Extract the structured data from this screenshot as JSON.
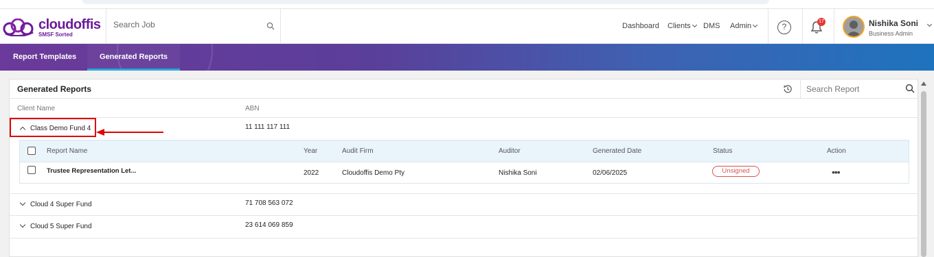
{
  "brand": {
    "name": "cloudoffis",
    "tagline": "SMSF Sorted",
    "color": "#6a1b9a"
  },
  "header": {
    "search_placeholder": "Search Job",
    "nav": {
      "dashboard": "Dashboard",
      "clients": "Clients",
      "dms": "DMS",
      "admin": "Admin"
    },
    "help_icon": "question-circle-icon",
    "notifications_count": "17",
    "user": {
      "name": "Nishika Soni",
      "role": "Business Admin"
    }
  },
  "tabs": [
    {
      "label": "Report Templates",
      "active": false
    },
    {
      "label": "Generated Reports",
      "active": true
    }
  ],
  "panel": {
    "title": "Generated Reports",
    "search_placeholder": "Search Report",
    "columns": {
      "client_name": "Client Name",
      "abn": "ABN"
    },
    "clients": [
      {
        "name": "Class Demo Fund 4",
        "abn": "11 111 117 111",
        "expanded": true
      },
      {
        "name": "Cloud 4 Super Fund",
        "abn": "71 708 563 072",
        "expanded": false
      },
      {
        "name": "Cloud 5 Super Fund",
        "abn": "23 614 069 859",
        "expanded": false
      }
    ],
    "sub_table": {
      "headers": {
        "report_name": "Report Name",
        "year": "Year",
        "audit_firm": "Audit Firm",
        "auditor": "Auditor",
        "generated_date": "Generated Date",
        "status": "Status",
        "action": "Action"
      },
      "rows": [
        {
          "report_name": "Trustee Representation Let...",
          "year": "2022",
          "audit_firm": "Cloudoffis Demo Pty",
          "auditor": "Nishika Soni",
          "generated_date": "02/06/2025",
          "status": "Unsigned",
          "action": "•••"
        }
      ]
    }
  },
  "colors": {
    "status_unsigned": "#d9534f",
    "annotation": "#e00000",
    "tab_active_underline": "#29a8e0"
  }
}
